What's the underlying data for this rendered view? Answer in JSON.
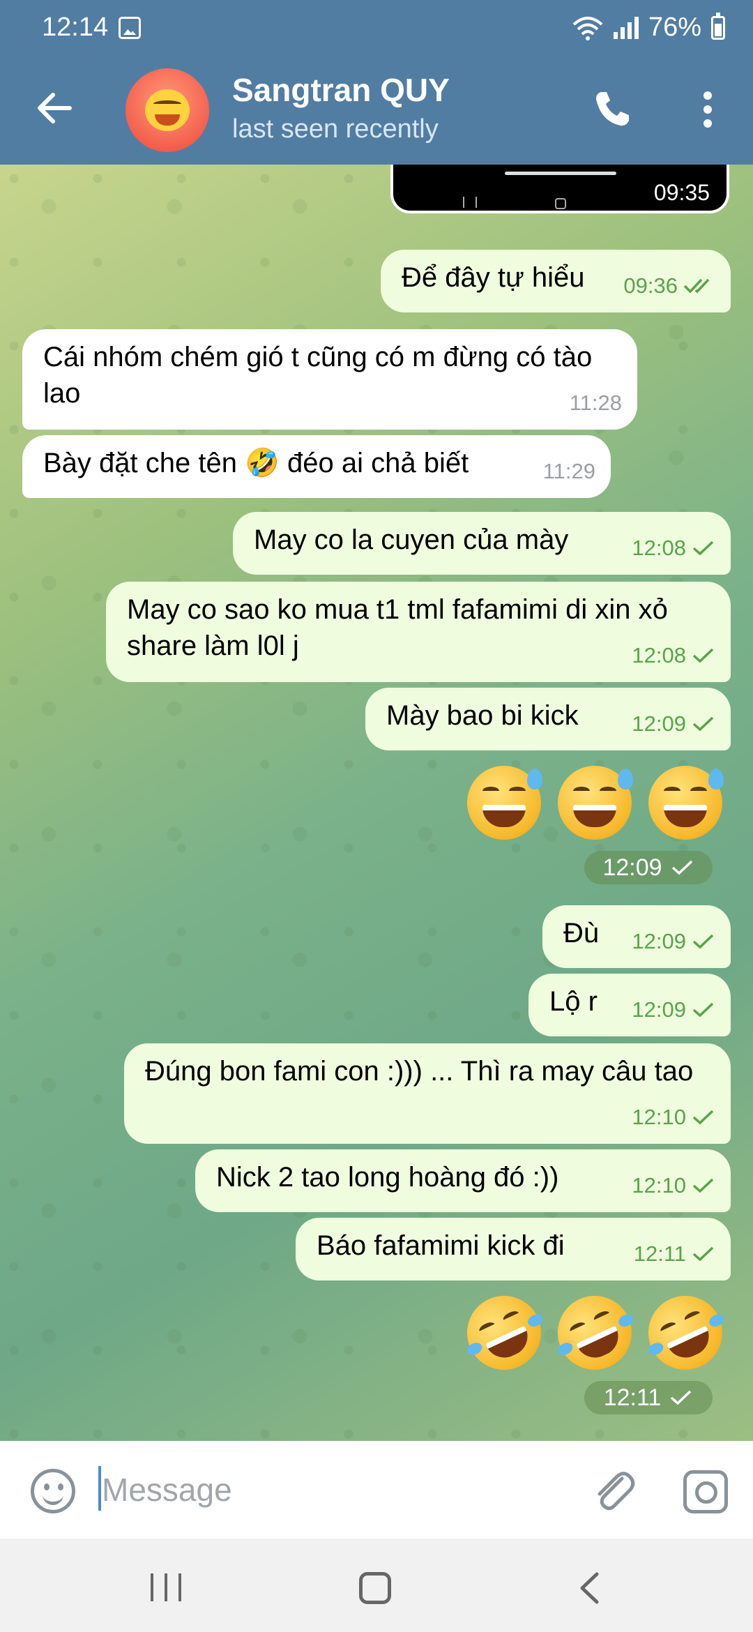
{
  "status_bar": {
    "time": "12:14",
    "battery": "76%"
  },
  "header": {
    "contact_name": "Sangtran QUY",
    "status": "last seen recently"
  },
  "photo_message": {
    "time": "09:35"
  },
  "messages": [
    {
      "text": "Để đây tự hiểu",
      "time": "09:36",
      "dir": "out"
    },
    {
      "text": "Cái nhóm chém gió t cũng có m đừng có tào lao",
      "time": "11:28",
      "dir": "in"
    },
    {
      "text": "Bày đặt che tên 🤣 đéo ai chả biết",
      "time": "11:29",
      "dir": "in"
    },
    {
      "text": "May co la cuyen của mày",
      "time": "12:08",
      "dir": "out"
    },
    {
      "text": "May co sao ko mua t1 tml fafamimi di xin xỏ share làm l0l j",
      "time": "12:08",
      "dir": "out"
    },
    {
      "text": "Mày bao bi kick",
      "time": "12:09",
      "dir": "out"
    },
    {
      "text": "Đù",
      "time": "12:09",
      "dir": "out"
    },
    {
      "text": "Lộ r",
      "time": "12:09",
      "dir": "out"
    },
    {
      "text": "Đúng bon fami con :))) ... Thì ra may câu tao",
      "time": "12:10",
      "dir": "out"
    },
    {
      "text": "Nick 2 tao long hoàng đó :))",
      "time": "12:10",
      "dir": "out"
    },
    {
      "text": "Báo fafamimi kick đi",
      "time": "12:11",
      "dir": "out"
    }
  ],
  "emoji_messages": [
    {
      "emoji": "grinning-sweat-x3",
      "time": "12:09"
    },
    {
      "emoji": "rofl-x3",
      "time": "12:11"
    }
  ],
  "input": {
    "placeholder": "Message"
  },
  "colors": {
    "header": "#527da3",
    "outgoing_bubble": "#effdde",
    "incoming_bubble": "#ffffff",
    "check": "#5aa34a"
  }
}
